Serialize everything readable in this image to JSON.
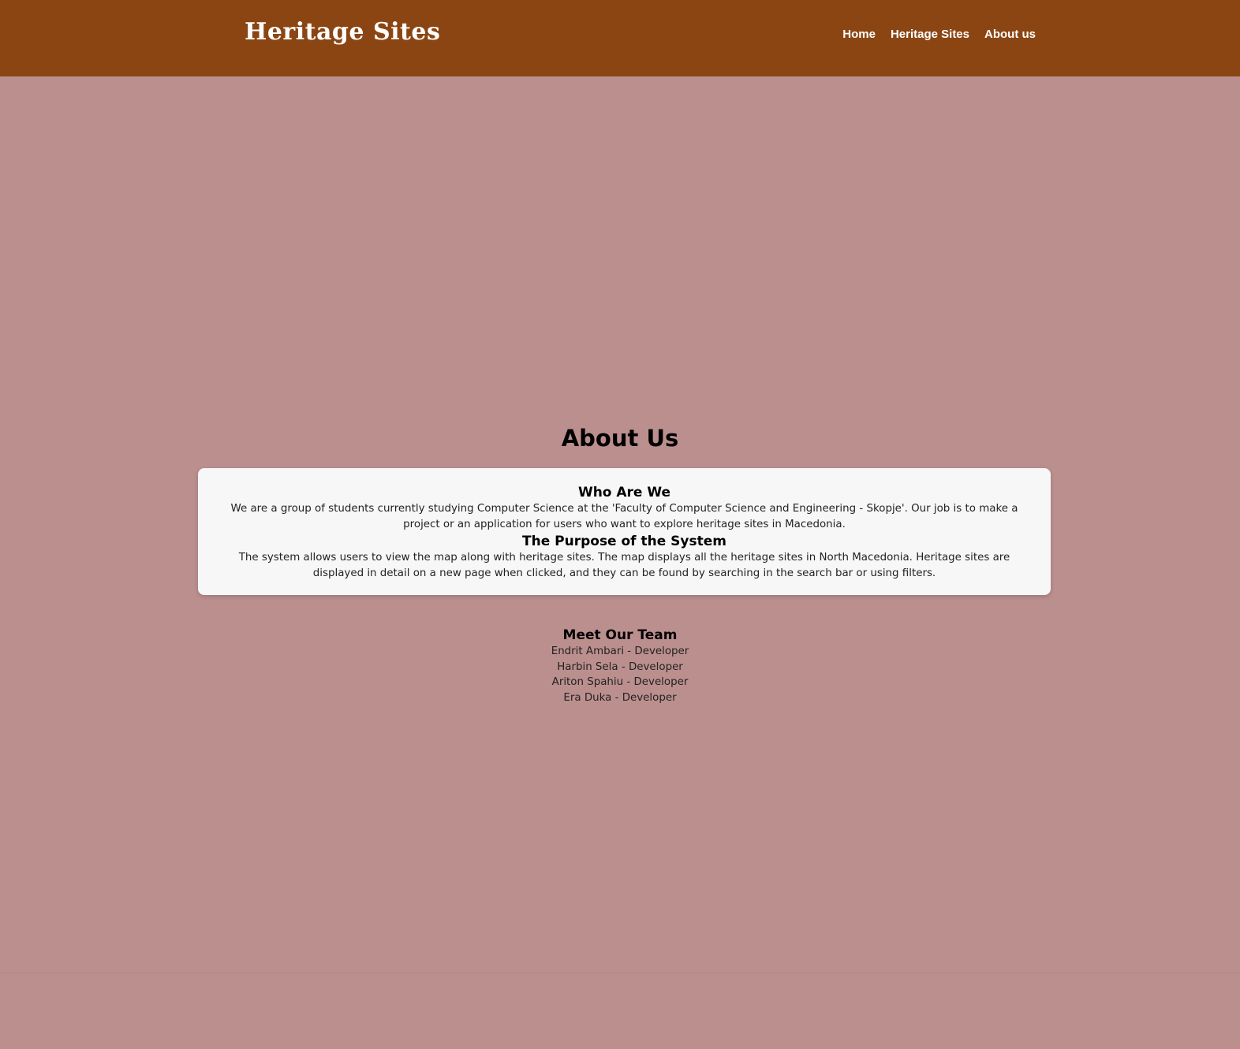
{
  "navbar": {
    "brand": "Heritage Sites",
    "links": [
      {
        "label": "Home"
      },
      {
        "label": "Heritage Sites"
      },
      {
        "label": "About us"
      }
    ]
  },
  "main": {
    "title": "About Us",
    "sections": [
      {
        "heading": "Who Are We",
        "text": "We are a group of students currently studying Computer Science at the 'Faculty of Computer Science and Engineering - Skopje'. Our job is to make a project or an application for users who want to explore heritage sites in Macedonia."
      },
      {
        "heading": "The Purpose of the System",
        "text": "The system allows users to view the map along with heritage sites. The map displays all the heritage sites in North Macedonia. Heritage sites are displayed in detail on a new page when clicked, and they can be found by searching in the search bar or using filters."
      }
    ],
    "team": {
      "heading": "Meet Our Team",
      "members": [
        "Endrit Ambari - Developer",
        "Harbin Sela - Developer",
        "Ariton Spahiu - Developer",
        "Era Duka - Developer"
      ]
    }
  },
  "colors": {
    "navbar_bg": "#8b4513",
    "page_bg": "#bc8f8f",
    "card_bg": "#f7f7f7"
  }
}
